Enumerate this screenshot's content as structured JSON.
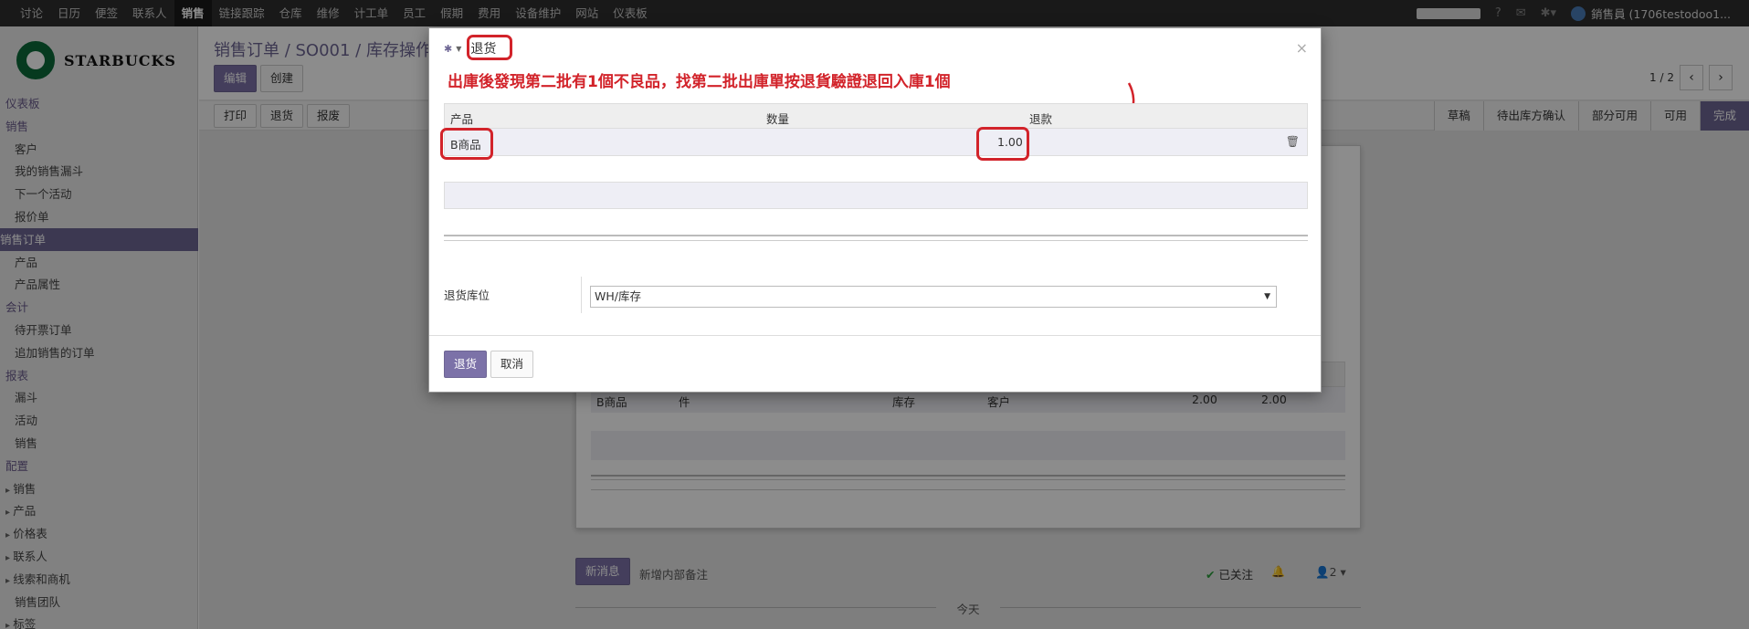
{
  "topnav": {
    "items": [
      "讨论",
      "日历",
      "便签",
      "联系人",
      "销售",
      "链接跟踪",
      "仓库",
      "维修",
      "计工单",
      "员工",
      "假期",
      "费用",
      "设备维护",
      "网站",
      "仪表板"
    ],
    "active_index": 4,
    "user_label": "銷售員 (1706testodoo1..."
  },
  "sidebar": {
    "brand": "STARBUCKS",
    "items": [
      {
        "label": "仪表板",
        "kind": "head"
      },
      {
        "label": "销售",
        "kind": "head"
      },
      {
        "label": "客户",
        "kind": "sub"
      },
      {
        "label": "我的销售漏斗",
        "kind": "sub"
      },
      {
        "label": "下一个活动",
        "kind": "sub"
      },
      {
        "label": "报价单",
        "kind": "sub"
      },
      {
        "label": "销售订单",
        "kind": "sel"
      },
      {
        "label": "产品",
        "kind": "sub"
      },
      {
        "label": "产品属性",
        "kind": "sub"
      },
      {
        "label": "会计",
        "kind": "head"
      },
      {
        "label": "待开票订单",
        "kind": "sub"
      },
      {
        "label": "追加销售的订单",
        "kind": "sub"
      },
      {
        "label": "报表",
        "kind": "head"
      },
      {
        "label": "漏斗",
        "kind": "sub"
      },
      {
        "label": "活动",
        "kind": "sub"
      },
      {
        "label": "销售",
        "kind": "sub"
      },
      {
        "label": "配置",
        "kind": "head"
      },
      {
        "label": "销售",
        "kind": "grp"
      },
      {
        "label": "产品",
        "kind": "grp"
      },
      {
        "label": "价格表",
        "kind": "grp"
      },
      {
        "label": "联系人",
        "kind": "grp"
      },
      {
        "label": "线索和商机",
        "kind": "grp"
      },
      {
        "label": "销售团队",
        "kind": "sub"
      },
      {
        "label": "标签",
        "kind": "grp"
      }
    ]
  },
  "main": {
    "breadcrumb": "销售订单 /  SO001 /  库存操作",
    "edit_label": "编辑",
    "create_label": "创建",
    "pager": "1 / 2",
    "action_buttons": [
      "打印",
      "退货",
      "报废"
    ],
    "steps": [
      "草稿",
      "待出库方确认",
      "部分可用",
      "可用",
      "完成"
    ],
    "bg_row": {
      "product": "B商品",
      "uom": "件",
      "from": "库存",
      "to": "客户",
      "qty1": "2.00",
      "qty2": "2.00"
    },
    "chatter": {
      "new_message": "新消息",
      "internal_note": "新增内部备注",
      "followed": "已关注",
      "followers": "2",
      "today": "今天"
    }
  },
  "modal": {
    "title": "退货",
    "annotation": "出庫後發現第二批有1個不良品，找第二批出庫單按退貨驗證退回入庫1個",
    "columns": [
      "产品",
      "数量",
      "退款"
    ],
    "row": {
      "product": "B商品",
      "qty": "1.00"
    },
    "location_label": "退货库位",
    "location_value": "WH/库存",
    "return_button": "退货",
    "cancel_button": "取消"
  },
  "colors": {
    "accent": "#6e6694",
    "annotation": "#d2232a"
  }
}
